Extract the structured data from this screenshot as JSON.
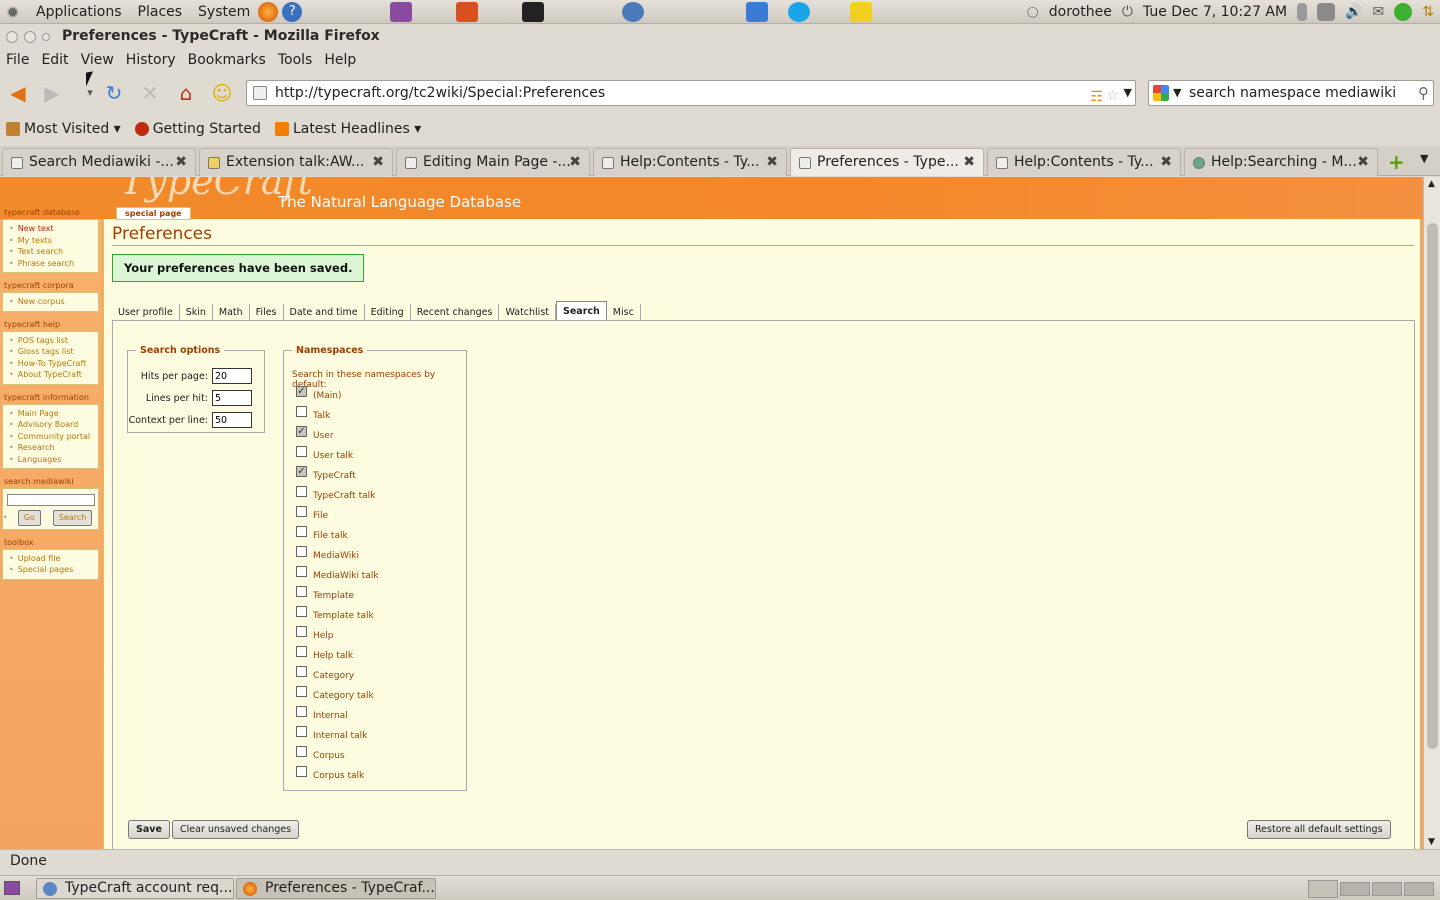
{
  "top_panel": {
    "menus": [
      "Applications",
      "Places",
      "System"
    ],
    "user": "dorothee",
    "clock": "Tue Dec  7, 10:27 AM"
  },
  "window": {
    "title": "Preferences - TypeCraft - Mozilla Firefox"
  },
  "menubar": [
    "File",
    "Edit",
    "View",
    "History",
    "Bookmarks",
    "Tools",
    "Help"
  ],
  "navbar": {
    "url": "http://typecraft.org/tc2wiki/Special:Preferences",
    "search": "search namespace mediawiki"
  },
  "bookmarks": [
    "Most Visited ▾",
    "Getting Started",
    "Latest Headlines ▾"
  ],
  "tabs": [
    {
      "label": "Search Mediawiki -..."
    },
    {
      "label": "Extension talk:AW..."
    },
    {
      "label": "Editing Main Page -..."
    },
    {
      "label": "Help:Contents - Ty..."
    },
    {
      "label": "Preferences - Type...",
      "active": true
    },
    {
      "label": "Help:Contents - Ty..."
    },
    {
      "label": "Help:Searching - M..."
    }
  ],
  "site": {
    "tagline": "The Natural Language Database",
    "special_tab": "special page"
  },
  "sidebar": {
    "sections": [
      {
        "title": "typecraft database",
        "items": [
          "New text",
          "My texts",
          "Text search",
          "Phrase search"
        ]
      },
      {
        "title": "typecraft corpora",
        "items": [
          "New corpus"
        ]
      },
      {
        "title": "typecraft help",
        "items": [
          "POS tags list",
          "Gloss tags list",
          "How-To TypeCraft",
          "About TypeCraft"
        ]
      },
      {
        "title": "typecraft information",
        "items": [
          "Main Page",
          "Advisory Board",
          "Community portal",
          "Research",
          "Languages"
        ]
      }
    ],
    "search_title": "search mediawiki",
    "go_label": "Go",
    "search_label": "Search",
    "toolbox_title": "toolbox",
    "toolbox_items": [
      "Upload file",
      "Special pages"
    ]
  },
  "page": {
    "title": "Preferences",
    "saved_message": "Your preferences have been saved.",
    "pref_tabs": [
      "User profile",
      "Skin",
      "Math",
      "Files",
      "Date and time",
      "Editing",
      "Recent changes",
      "Watchlist",
      "Search",
      "Misc"
    ],
    "active_tab": "Search",
    "search_options": {
      "legend": "Search options",
      "hits_label": "Hits per page:",
      "hits_value": "20",
      "lines_label": "Lines per hit:",
      "lines_value": "5",
      "context_label": "Context per line:",
      "context_value": "50"
    },
    "namespaces": {
      "legend": "Namespaces",
      "intro": "Search in these namespaces by default:",
      "items": [
        {
          "label": "(Main)",
          "checked": true
        },
        {
          "label": "Talk",
          "checked": false
        },
        {
          "label": "User",
          "checked": true
        },
        {
          "label": "User talk",
          "checked": false
        },
        {
          "label": "TypeCraft",
          "checked": true
        },
        {
          "label": "TypeCraft talk",
          "checked": false
        },
        {
          "label": "File",
          "checked": false
        },
        {
          "label": "File talk",
          "checked": false
        },
        {
          "label": "MediaWiki",
          "checked": false
        },
        {
          "label": "MediaWiki talk",
          "checked": false
        },
        {
          "label": "Template",
          "checked": false
        },
        {
          "label": "Template talk",
          "checked": false
        },
        {
          "label": "Help",
          "checked": false
        },
        {
          "label": "Help talk",
          "checked": false
        },
        {
          "label": "Category",
          "checked": false
        },
        {
          "label": "Category talk",
          "checked": false
        },
        {
          "label": "Internal",
          "checked": false
        },
        {
          "label": "Internal talk",
          "checked": false
        },
        {
          "label": "Corpus",
          "checked": false
        },
        {
          "label": "Corpus talk",
          "checked": false
        }
      ]
    },
    "save_label": "Save",
    "clear_label": "Clear unsaved changes",
    "restore_label": "Restore all default settings"
  },
  "status": "Done",
  "taskbar": [
    {
      "label": "TypeCraft account req..."
    },
    {
      "label": "Preferences - TypeCraf...",
      "active": true
    }
  ],
  "colors": {
    "banner": "#f08a2a",
    "accent_text": "#a14000",
    "content_bg": "#fdfbe0",
    "saved_bg": "#dcf5d4"
  }
}
